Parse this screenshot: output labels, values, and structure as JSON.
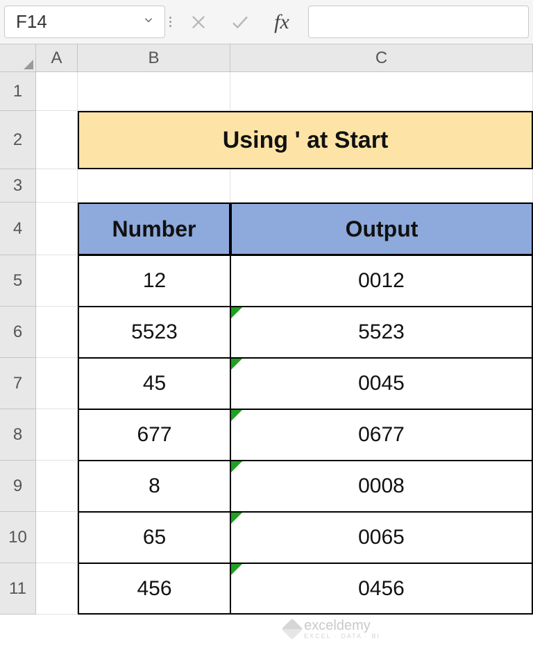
{
  "formula_bar": {
    "cell_reference": "F14",
    "formula_value": "",
    "fx_label": "fx"
  },
  "columns": [
    "A",
    "B",
    "C"
  ],
  "rows": [
    "1",
    "2",
    "3",
    "4",
    "5",
    "6",
    "7",
    "8",
    "9",
    "10",
    "11"
  ],
  "title": "Using ' at Start",
  "headers": {
    "number": "Number",
    "output": "Output"
  },
  "table": [
    {
      "number": "12",
      "output": "0012",
      "err": false
    },
    {
      "number": "5523",
      "output": "5523",
      "err": true
    },
    {
      "number": "45",
      "output": "0045",
      "err": true
    },
    {
      "number": "677",
      "output": "0677",
      "err": true
    },
    {
      "number": "8",
      "output": "0008",
      "err": true
    },
    {
      "number": "65",
      "output": "0065",
      "err": true
    },
    {
      "number": "456",
      "output": "0456",
      "err": true
    }
  ],
  "watermark": {
    "brand": "exceldemy",
    "tag": "EXCEL · DATA · BI"
  },
  "colors": {
    "title_bg": "#fde4a6",
    "header_bg": "#8ea9db",
    "error_triangle": "#21a121"
  }
}
